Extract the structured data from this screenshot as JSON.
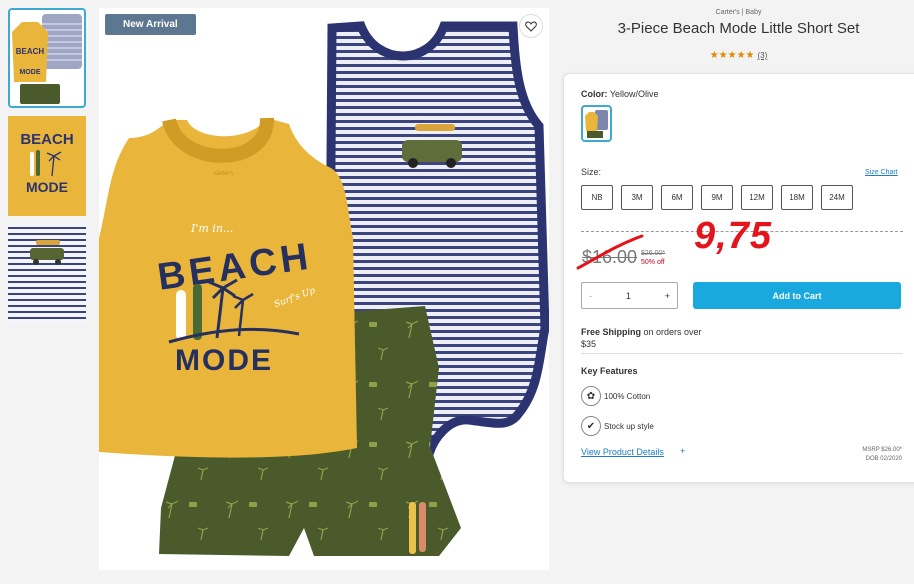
{
  "product": {
    "badge": "New Arrival",
    "brand": "Carter's | Baby",
    "title": "3-Piece Beach Mode Little Short Set",
    "stars": "★★★★★",
    "review_count": "(3)",
    "image_text": {
      "im_in": "I'm in...",
      "beach": "BEACH",
      "surfs_up": "Surf's Up",
      "mode": "MODE",
      "tag": "carter's"
    }
  },
  "color": {
    "label": "Color:",
    "value": "Yellow/Olive"
  },
  "size": {
    "label": "Size:",
    "chart_link": "Size Chart",
    "options": [
      "NB",
      "3M",
      "6M",
      "9M",
      "12M",
      "18M",
      "24M"
    ]
  },
  "price": {
    "current": "$16.00",
    "original": "$26.00*",
    "discount": "50% off",
    "handwritten": "9,75"
  },
  "quantity": {
    "minus": "-",
    "value": "1",
    "plus": "+"
  },
  "cart": {
    "label": "Add to Cart"
  },
  "shipping": {
    "bold": "Free Shipping",
    "text": " on orders over",
    "amount": "$35"
  },
  "features": {
    "heading": "Key Features",
    "items": [
      {
        "label": "100% Cotton",
        "icon": "cotton-icon"
      },
      {
        "label": "Stock up style",
        "icon": "checkmark-icon"
      }
    ]
  },
  "details": {
    "label": "View Product Details",
    "plus": "+"
  },
  "msrp": {
    "line1": "MSRP $26.00*",
    "line2": "DOB 02/2020"
  },
  "colors": {
    "accent": "#19a9df",
    "badge": "#5d7791",
    "star": "#e08a00",
    "red": "#e3141c",
    "tank": "#e9b63b",
    "navy": "#2b3470",
    "olive": "#4a5a2b"
  }
}
